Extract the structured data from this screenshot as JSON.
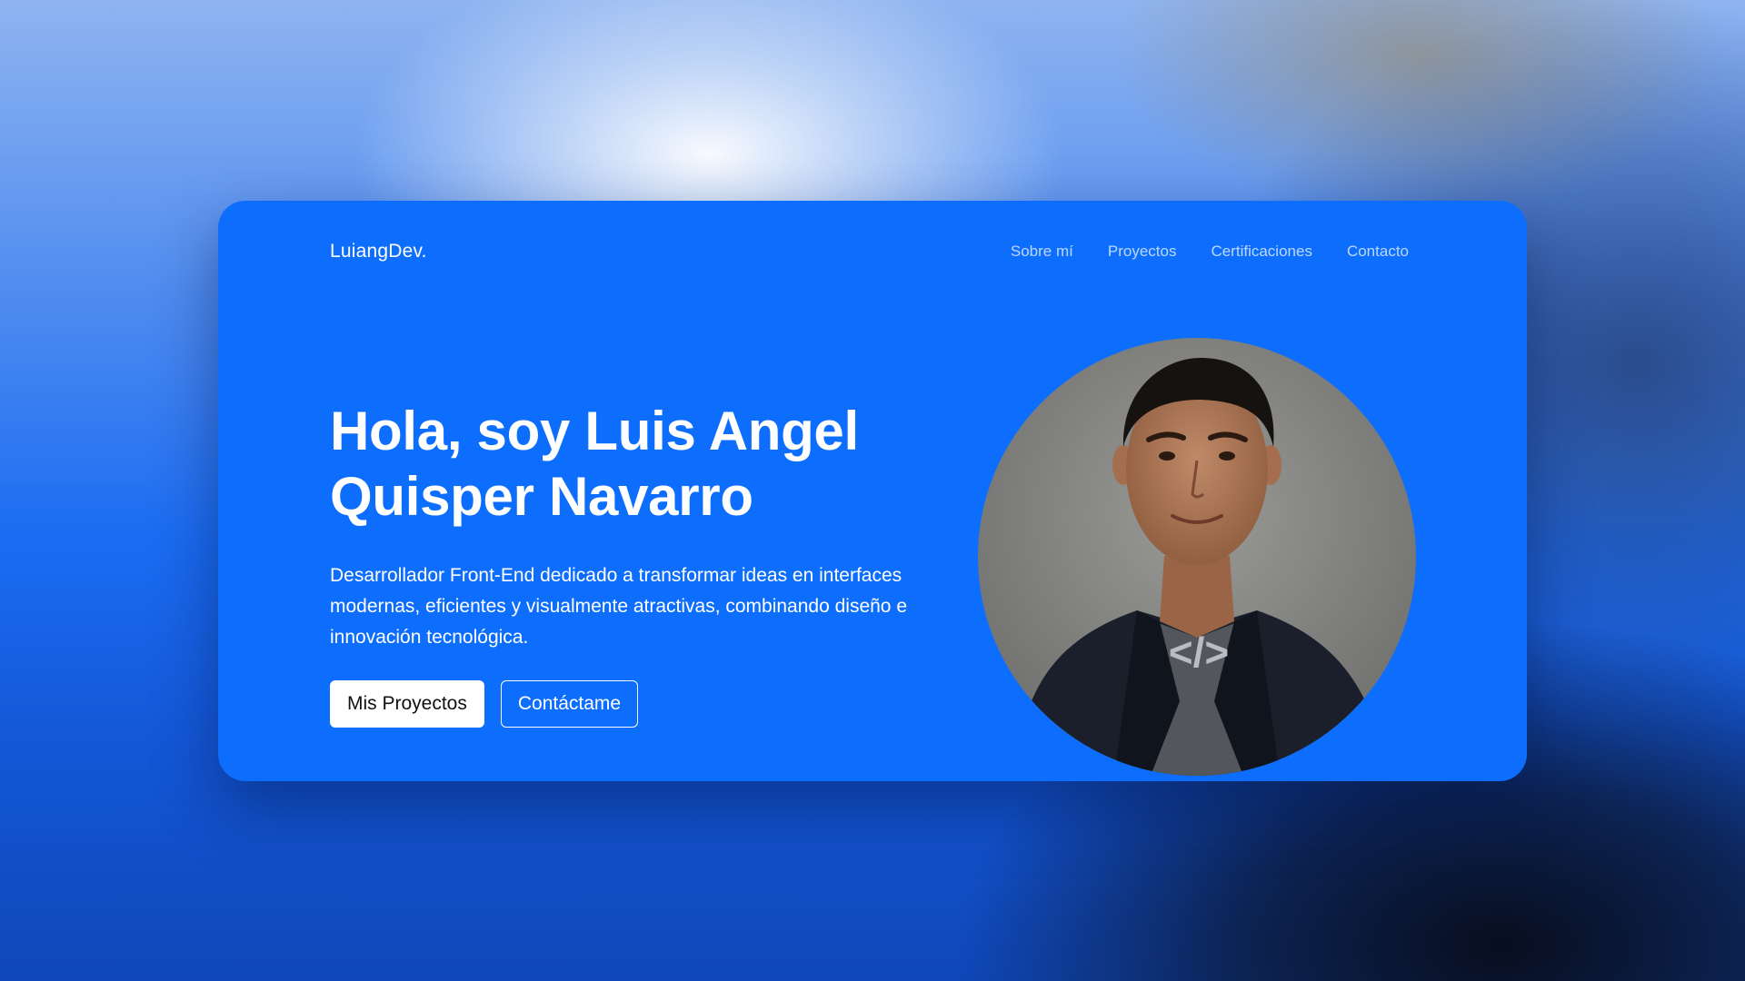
{
  "nav": {
    "logo": "LuiangDev.",
    "links": [
      "Sobre mí",
      "Proyectos",
      "Certificaciones",
      "Contacto"
    ]
  },
  "hero": {
    "title_line1": "Hola, soy Luis Angel",
    "title_line2": "Quisper Navarro",
    "description": "Desarrollador Front-End dedicado a transformar ideas en interfaces modernas, eficientes y visualmente atractivas, combinando diseño e innovación tecnológica.",
    "primary_button": "Mis Proyectos",
    "secondary_button": "Contáctame",
    "shirt_symbol": "</>"
  },
  "colors": {
    "card_bg": "#0d6efd",
    "text": "#ffffff",
    "primary_button_bg": "#ffffff"
  }
}
